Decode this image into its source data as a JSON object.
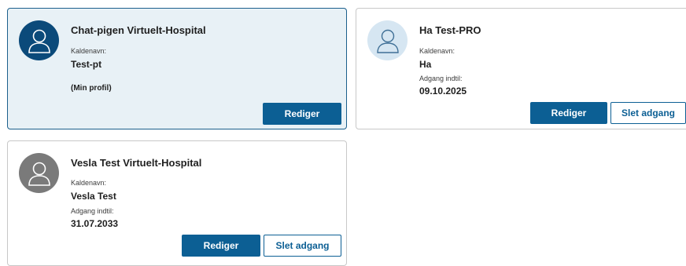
{
  "profiles": [
    {
      "name": "Chat-pigen Virtuelt-Hospital",
      "nickname_label": "Kaldenavn:",
      "nickname": "Test-pt",
      "own_profile_note": "(Min profil)",
      "edit_label": "Rediger",
      "avatar_icon": "user-avatar-icon",
      "selected": true
    },
    {
      "name": "Ha Test-PRO",
      "nickname_label": "Kaldenavn:",
      "nickname": "Ha",
      "access_label": "Adgang indtil:",
      "access_until": "09.10.2025",
      "edit_label": "Rediger",
      "remove_label": "Slet adgang",
      "avatar_icon": "user-avatar-icon"
    },
    {
      "name": "Vesla Test Virtuelt-Hospital",
      "nickname_label": "Kaldenavn:",
      "nickname": "Vesla Test",
      "access_label": "Adgang indtil:",
      "access_until": "31.07.2033",
      "edit_label": "Rediger",
      "remove_label": "Slet adgang",
      "avatar_icon": "user-avatar-icon"
    }
  ],
  "colors": {
    "primary": "#0c5f94",
    "selected_card_bg": "#e8f1f6",
    "avatar_dark": "#0b4a7a",
    "avatar_light": "#d6e6f2",
    "avatar_gray": "#7a7a7a"
  }
}
